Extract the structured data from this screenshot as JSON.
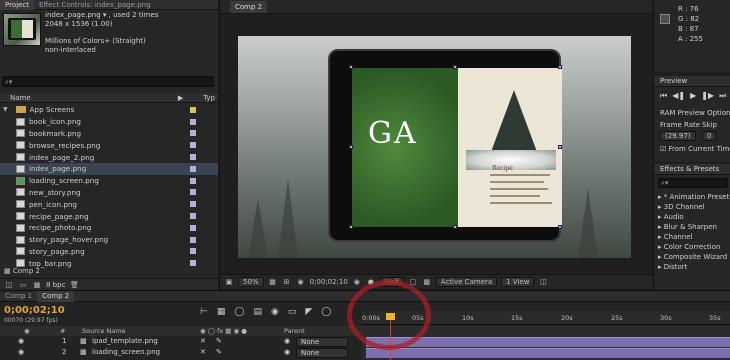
{
  "project_panel": {
    "tabs": [
      "Project",
      "Effect Controls: index_page.png"
    ],
    "asset_name": "index_page.png ▾ , used 2 times",
    "dimensions": "2048 x 1536 (1.00)",
    "color_info": "Millions of Colors+ (Straight)",
    "interlace": "non-interlaced",
    "search_placeholder": "⌕▾",
    "col_name": "Name",
    "col_type": "Typ",
    "folder": "App Screens",
    "files": [
      "book_icon.png",
      "bookmark.png",
      "browse_recipes.png",
      "index_page_2.png",
      "index_page.png",
      "loading_screen.png",
      "new_story.png",
      "pen_icon.png",
      "recipe_page.png",
      "recipe_photo.png",
      "story_page_hover.png",
      "story_page.png",
      "top_bar.png"
    ],
    "selected_file": "index_page.png",
    "comp_item": "Comp 2",
    "bpc": "8 bpc"
  },
  "viewer": {
    "tab": "Comp 2",
    "title_text": "GA",
    "recipe_title": "Recipe",
    "zoom": "50%",
    "timecode": "0;00;02;10",
    "resolution": "Half",
    "camera": "Active Camera",
    "views": "1 View"
  },
  "info_panel": {
    "r": "R : 76",
    "g": "G : 82",
    "b": "B : 87",
    "a": "A : 255"
  },
  "preview_panel": {
    "title": "Preview",
    "ram_title": "RAM Preview Option",
    "frame_rate_label": "Frame Rate",
    "skip_label": "Skip",
    "frame_rate_value": "(29.97)",
    "skip_value": "0",
    "from_current": "From Current Time"
  },
  "effects_panel": {
    "title": "Effects & Presets",
    "search_placeholder": "⌕▾",
    "items": [
      "* Animation Presets",
      "3D Channel",
      "Audio",
      "Blur & Sharpen",
      "Channel",
      "Color Correction",
      "Composite Wizard",
      "Distort"
    ]
  },
  "timeline": {
    "tabs": [
      "Comp 1",
      "Comp 2"
    ],
    "timecode": "0;00;02;10",
    "frames": "00070 (29.97 fps)",
    "source_header": "Source Name",
    "parent_header": "Parent",
    "layers": [
      {
        "num": "1",
        "name": "ipad_template.png",
        "parent": "None"
      },
      {
        "num": "2",
        "name": "loading_screen.png",
        "parent": "None"
      }
    ],
    "ruler_ticks": [
      "0:00s",
      "05s",
      "10s",
      "15s",
      "20s",
      "25s",
      "30s",
      "35s"
    ]
  }
}
